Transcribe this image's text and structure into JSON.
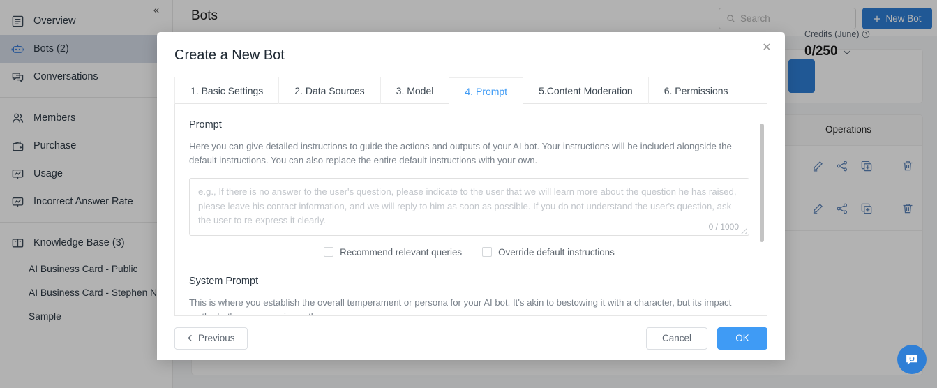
{
  "sidebar": {
    "collapse_icon": "chevrons-left-icon",
    "items": [
      {
        "label": "Overview",
        "icon": "list-panel-icon",
        "active": false
      },
      {
        "label": "Bots (2)",
        "icon": "robot-icon",
        "active": true
      },
      {
        "label": "Conversations",
        "icon": "chat-bubbles-icon",
        "active": false
      },
      {
        "label": "Members",
        "icon": "people-icon",
        "active": false
      },
      {
        "label": "Purchase",
        "icon": "wallet-icon",
        "active": false
      },
      {
        "label": "Usage",
        "icon": "chart-board-icon",
        "active": false
      },
      {
        "label": "Incorrect Answer Rate",
        "icon": "chart-board-icon",
        "active": false
      },
      {
        "label": "Knowledge Base (3)",
        "icon": "book-icon",
        "active": false
      }
    ],
    "knowledge_base_children": [
      "AI Business Card - Public",
      "AI Business Card - Stephen Ng.",
      "Sample"
    ]
  },
  "topbar": {
    "page_title": "Bots",
    "search_placeholder": "Search",
    "search_icon": "search-icon",
    "new_bot_label": "New Bot",
    "new_bot_icon": "plus-icon"
  },
  "credits": {
    "label": "Credits (June)",
    "help_icon": "question-circle-icon",
    "value": "0/250",
    "chevron_icon": "chevron-down-icon"
  },
  "bots_table": {
    "operations_header": "Operations",
    "row_icons": [
      "edit-pencil-icon",
      "share-icon",
      "duplicate-icon",
      "delete-trash-icon"
    ],
    "row_count": 2
  },
  "chat_fab": {
    "icon": "chat-smiley-icon"
  },
  "modal": {
    "title": "Create a New Bot",
    "close_icon": "close-icon",
    "tabs": [
      {
        "label": "1. Basic Settings",
        "active": false
      },
      {
        "label": "2. Data Sources",
        "active": false
      },
      {
        "label": "3. Model",
        "active": false
      },
      {
        "label": "4. Prompt",
        "active": true
      },
      {
        "label": "5.Content Moderation",
        "active": false
      },
      {
        "label": "6. Permissions",
        "active": false
      }
    ],
    "prompt_section": {
      "title": "Prompt",
      "description": "Here you can give detailed instructions to guide the actions and outputs of your AI bot. Your instructions will be included alongside the default instructions. You can also replace the entire default instructions with your own.",
      "textarea_placeholder": "e.g., If there is no answer to the user's question, please indicate to the user that we will learn more about the question he has raised, please leave his contact information, and we will reply to him as soon as possible. If you do not understand the user's question, ask the user to re-express it clearly.",
      "textarea_value": "",
      "counter": "0 / 1000",
      "checkboxes": [
        {
          "label": "Recommend relevant queries",
          "checked": false
        },
        {
          "label": "Override default instructions",
          "checked": false
        }
      ]
    },
    "system_prompt_section": {
      "title": "System Prompt",
      "description": "This is where you establish the overall temperament or persona for your AI bot. It's akin to bestowing it with a character, but its impact on the bot's responses is gentler.",
      "textarea_value": ""
    },
    "footer": {
      "previous_label": "Previous",
      "previous_icon": "chevron-left-icon",
      "cancel_label": "Cancel",
      "ok_label": "OK"
    }
  },
  "colors": {
    "accent": "#3f9bf5",
    "primary_button": "#2f7fd6",
    "sidebar_active": "#d6dde8",
    "icon_blue": "#5b83b8"
  }
}
